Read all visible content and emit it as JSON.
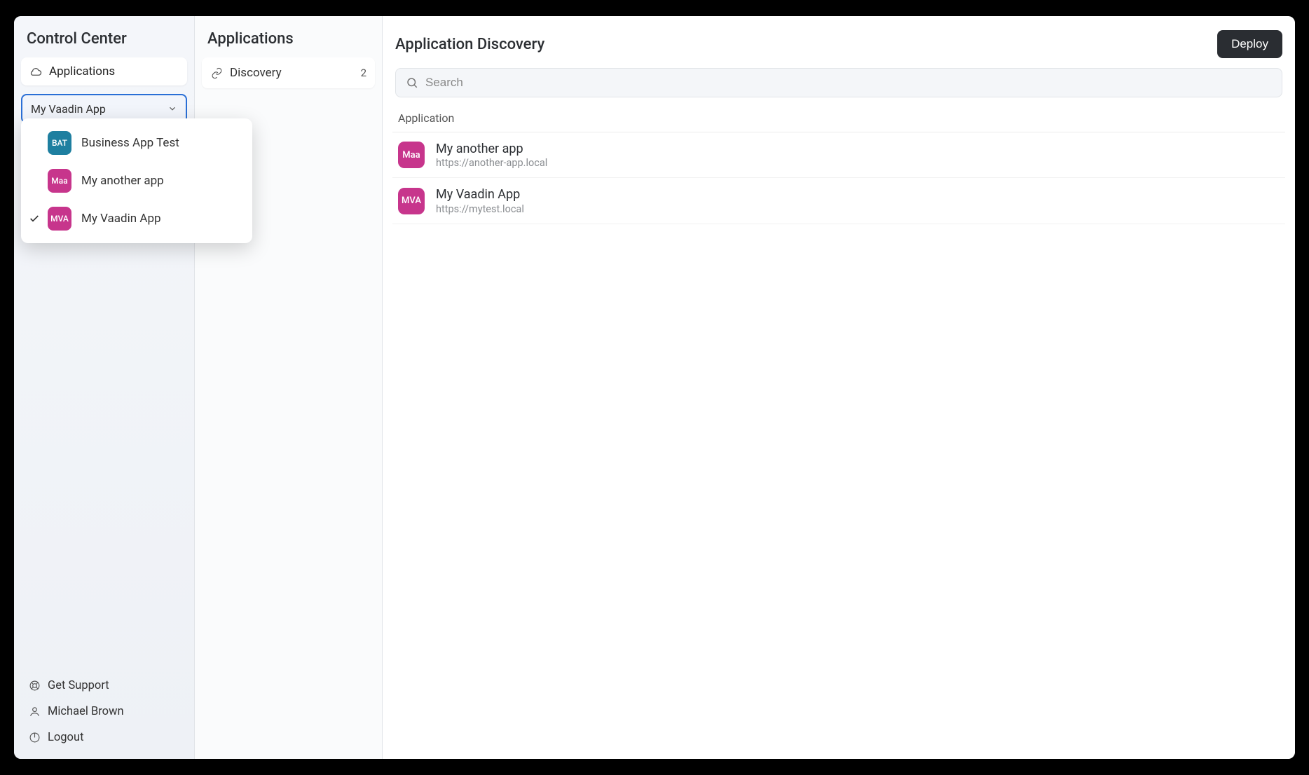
{
  "sidebar": {
    "title": "Control Center",
    "nav": {
      "applications_label": "Applications"
    },
    "combo": {
      "selected_label": "My Vaadin App",
      "options": [
        {
          "abbr": "BAT",
          "label": "Business App Test",
          "color": "teal",
          "selected": false
        },
        {
          "abbr": "Maa",
          "label": "My another app",
          "color": "pink",
          "selected": false
        },
        {
          "abbr": "MVA",
          "label": "My Vaadin App",
          "color": "pink",
          "selected": true
        }
      ]
    },
    "footer": {
      "support_label": "Get Support",
      "user_label": "Michael Brown",
      "logout_label": "Logout"
    }
  },
  "midcol": {
    "title": "Applications",
    "items": [
      {
        "label": "Discovery",
        "count": "2"
      }
    ]
  },
  "main": {
    "title": "Application Discovery",
    "deploy_label": "Deploy",
    "search_placeholder": "Search",
    "table": {
      "column_header": "Application",
      "rows": [
        {
          "abbr": "Maa",
          "name": "My another app",
          "url": "https://another-app.local"
        },
        {
          "abbr": "MVA",
          "name": "My Vaadin App",
          "url": "https://mytest.local"
        }
      ]
    }
  }
}
